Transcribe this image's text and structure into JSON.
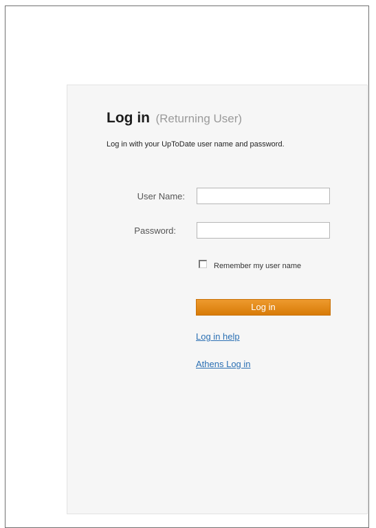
{
  "login": {
    "title": "Log in",
    "subtitle": "(Returning User)",
    "intro": "Log in with your UpToDate user name and password.",
    "username_label": "User Name:",
    "username_value": "",
    "password_label": "Password:",
    "password_value": "",
    "remember_label": "Remember my user name",
    "remember_checked": false,
    "submit_label": "Log in",
    "help_link": "Log in help",
    "athens_link": "Athens Log in"
  },
  "colors": {
    "button": "#e08a1a",
    "link": "#2a6fb3",
    "panel": "#f6f6f6"
  }
}
